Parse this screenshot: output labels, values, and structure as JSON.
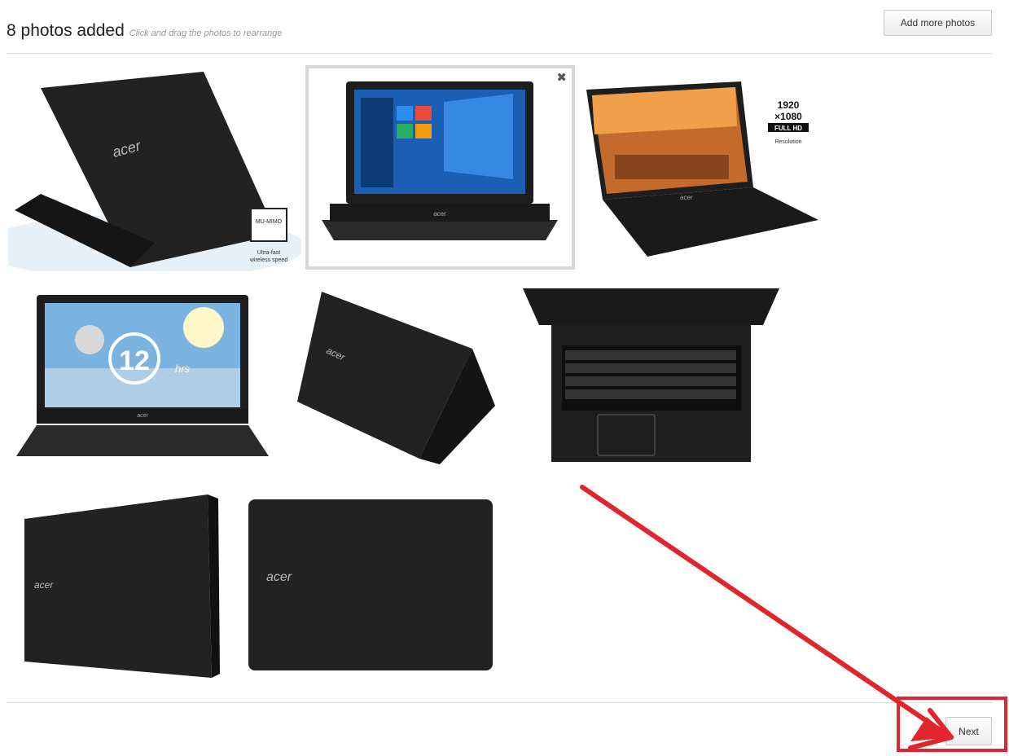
{
  "header": {
    "title": "8 photos added",
    "hint": "Click and drag the photos to rearrange",
    "add_button": "Add more photos"
  },
  "photos": [
    {
      "alt": "laptop-rear-view",
      "logo": "acer",
      "badge_title": "MU-MIMO",
      "badge_caption_1": "Ultra-fast",
      "badge_caption_2": "wireless speed"
    },
    {
      "alt": "laptop-front-windows",
      "logo": "acer",
      "close": "✖"
    },
    {
      "alt": "laptop-city-wallpaper",
      "logo": "acer",
      "badge_line_1": "1920",
      "badge_line_2": "×1080",
      "badge_line_3": "FULL HD",
      "badge_caption": "Resolution"
    },
    {
      "alt": "laptop-battery-12hrs",
      "logo": "acer",
      "battery_number": "12",
      "battery_unit": "hrs"
    },
    {
      "alt": "laptop-lid-angled",
      "logo": "acer"
    },
    {
      "alt": "laptop-keyboard-top",
      "logo": ""
    },
    {
      "alt": "laptop-lid-side",
      "logo": "acer"
    },
    {
      "alt": "laptop-lid-flat",
      "logo": "acer"
    }
  ],
  "footer": {
    "next_button": "Next"
  },
  "colors": {
    "annotation": "#e0262c",
    "laptop": "#1e1e1e",
    "selected_border": "#d6d6d6"
  }
}
